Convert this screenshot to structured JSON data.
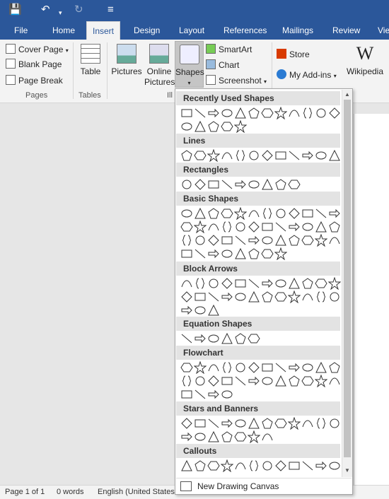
{
  "tabs": [
    "File",
    "Home",
    "Insert",
    "Design",
    "Layout",
    "References",
    "Mailings",
    "Review",
    "Vie"
  ],
  "ribbon": {
    "pages": {
      "cover": "Cover Page",
      "blank": "Blank Page",
      "break": "Page Break",
      "group": "Pages"
    },
    "tables": {
      "table": "Table",
      "group": "Tables"
    },
    "pictures": "Pictures",
    "online1": "Online",
    "online2": "Pictures",
    "shapes": "Shapes",
    "smartart": "SmartArt",
    "chart": "Chart",
    "screenshot": "Screenshot",
    "ill": "Ill",
    "store": "Store",
    "addins": "My Add-ins",
    "wiki": "Wikipedia"
  },
  "gallery": {
    "sections": [
      "Recently Used Shapes",
      "Lines",
      "Rectangles",
      "Basic Shapes",
      "Block Arrows",
      "Equation Shapes",
      "Flowchart",
      "Stars and Banners",
      "Callouts"
    ],
    "new_canvas": "New Drawing Canvas"
  },
  "status": {
    "page": "Page 1 of 1",
    "words": "0 words",
    "lang": "English (United States"
  },
  "colors": {
    "accent": "#2b579a",
    "store": "#d83b01"
  }
}
